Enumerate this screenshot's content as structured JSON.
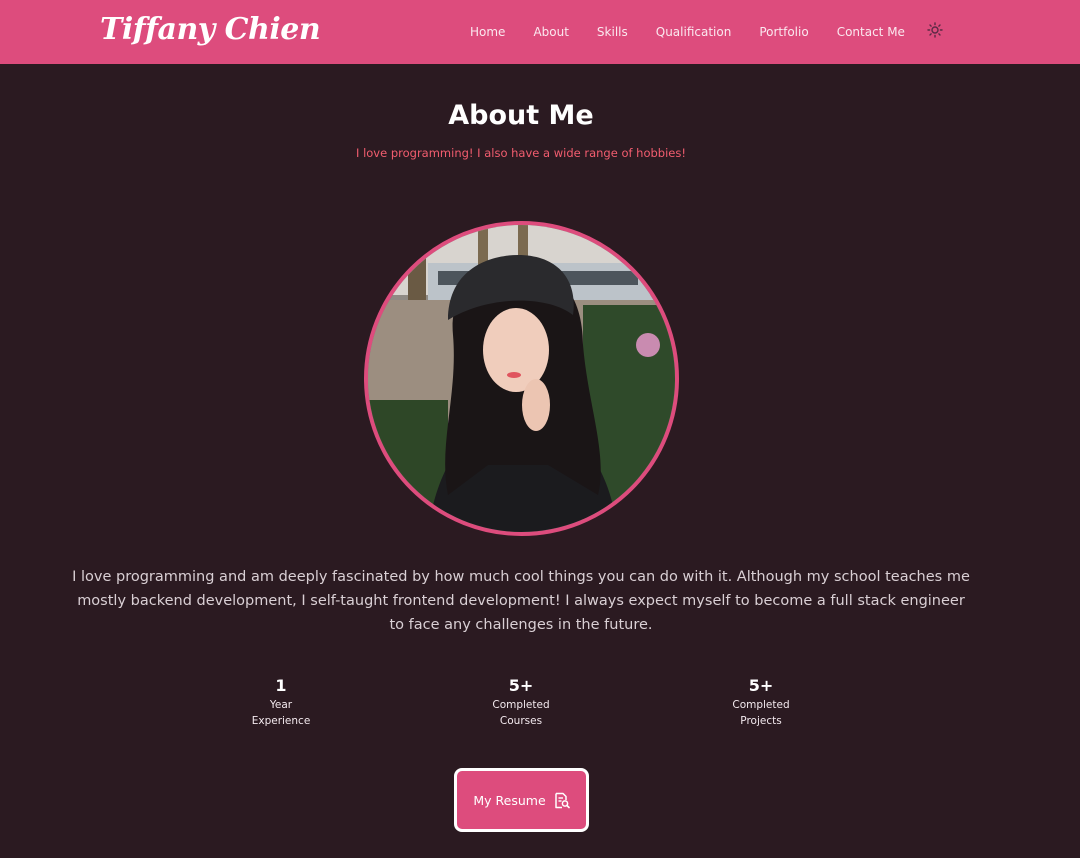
{
  "header": {
    "logo": "Tiffany Chien",
    "nav": [
      "Home",
      "About",
      "Skills",
      "Qualification",
      "Portfolio",
      "Contact Me"
    ],
    "theme_icon": "sun-icon",
    "accent_color": "#dd4c7d"
  },
  "about": {
    "title": "About Me",
    "subtitle": "I love programming! I also have a wide range of hobbies!",
    "photo_icon": "profile-photo",
    "description": "I love programming and am deeply fascinated by how much cool things you can do with it. Although my school teaches me mostly backend development, I self-taught frontend development! I always expect myself to become a full stack engineer to face any challenges in the future.",
    "stats": [
      {
        "value": "1",
        "label_line1": "Year",
        "label_line2": "Experience"
      },
      {
        "value": "5+",
        "label_line1": "Completed",
        "label_line2": "Courses"
      },
      {
        "value": "5+",
        "label_line1": "Completed",
        "label_line2": "Projects"
      }
    ],
    "resume_button": "My Resume",
    "resume_icon": "document-search-icon"
  },
  "colors": {
    "background": "#2b1a21",
    "subtitle": "#f25d6f"
  }
}
